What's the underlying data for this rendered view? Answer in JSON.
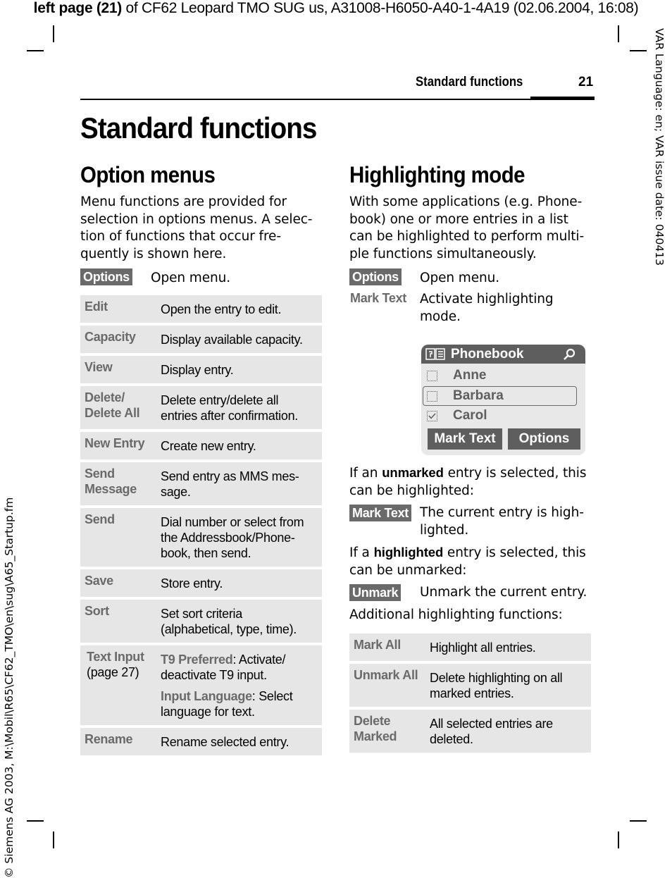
{
  "print_header": {
    "bold_part": "left page (21)",
    "rest": " of CF62 Leopard TMO SUG us, A31008-H6050-A40-1-4A19 (02.06.2004, 16:08)"
  },
  "side_right": "VAR Language: en; VAR issue date: 040413",
  "side_left": "© Siemens AG 2003, M:\\Mobil\\R65\\CF62_TMO\\en\\sug\\A65_Startup.fm",
  "running_head": {
    "title": "Standard functions",
    "page": "21"
  },
  "page_title": "Standard functions",
  "left": {
    "heading": "Option menus",
    "intro": [
      "Menu functions are provided for",
      "selection in options menus. A selec-",
      "tion of functions that occur fre-",
      "quently is shown here."
    ],
    "softkey": {
      "key": "Options",
      "desc": "Open menu."
    },
    "table": [
      {
        "key": [
          "Edit"
        ],
        "value": [
          "Open the entry to edit."
        ]
      },
      {
        "key": [
          "Capacity"
        ],
        "value": [
          "Display available capacity."
        ]
      },
      {
        "key": [
          "View"
        ],
        "value": [
          "Display entry."
        ]
      },
      {
        "key": [
          "Delete/",
          "Delete All"
        ],
        "value": [
          "Delete entry/delete all",
          "entries after confirmation."
        ]
      },
      {
        "key": [
          "New Entry"
        ],
        "value": [
          "Create new entry."
        ]
      },
      {
        "key": [
          "Send",
          "Message"
        ],
        "value": [
          "Send entry as MMS mes-",
          "sage."
        ]
      },
      {
        "key": [
          "Send"
        ],
        "value": [
          "Dial number or select from",
          "the Addressbook/Phone-",
          "book, then send."
        ]
      },
      {
        "key": [
          "Save"
        ],
        "value": [
          "Store entry."
        ]
      },
      {
        "key": [
          "Sort"
        ],
        "value": [
          "Set sort criteria",
          "(alphabetical, type, time)."
        ]
      },
      {
        "key": [
          "Text Input"
        ],
        "key_note": "(page 27)",
        "sub": [
          {
            "term": "T9 Preferred",
            "text": ": Activate/",
            "text2": "deactivate T9 input."
          },
          {
            "term": "Input Language",
            "text": ": Select",
            "text2": "language for text."
          }
        ]
      },
      {
        "key": [
          "Rename"
        ],
        "value": [
          "Rename selected entry."
        ]
      }
    ]
  },
  "right": {
    "heading": "Highlighting mode",
    "intro": [
      "With some applications (e.g. Phone-",
      "book) one or more entries in a list",
      "can be highlighted to perform multi-",
      "ple functions simultaneously."
    ],
    "softkey_options": {
      "key": "Options",
      "desc": "Open menu."
    },
    "mark_text_line": {
      "key": "Mark Text",
      "desc": [
        "Activate highlighting",
        "mode."
      ]
    },
    "phone": {
      "title": "Phonebook",
      "items": [
        {
          "name": "Anne",
          "checked": false,
          "selected": false
        },
        {
          "name": "Barbara",
          "checked": false,
          "selected": true
        },
        {
          "name": "Carol",
          "checked": true,
          "selected": false
        }
      ],
      "left_softkey": "Mark Text",
      "right_softkey": "Options"
    },
    "unmarked_para": {
      "pre": "If an ",
      "bold": "unmarked",
      "post": " entry is selected, this",
      "line2": "can be highlighted:"
    },
    "mark_text_key": {
      "key": "Mark Text",
      "desc": [
        "The current entry is high-",
        "lighted."
      ]
    },
    "highlighted_para": {
      "pre": "If a ",
      "bold": "highlighted",
      "post": " entry is selected, this",
      "line2": "can be unmarked:"
    },
    "unmark_key": {
      "key": "Unmark",
      "desc": "Unmark the current entry."
    },
    "additional": "Additional highlighting functions:",
    "table": [
      {
        "key": [
          "Mark All"
        ],
        "value": [
          "Highlight all entries."
        ]
      },
      {
        "key": [
          "Unmark All"
        ],
        "value": [
          "Delete highlighting on all",
          "marked entries."
        ]
      },
      {
        "key": [
          "Delete",
          "Marked"
        ],
        "value": [
          "All selected entries are",
          "deleted."
        ]
      }
    ]
  }
}
